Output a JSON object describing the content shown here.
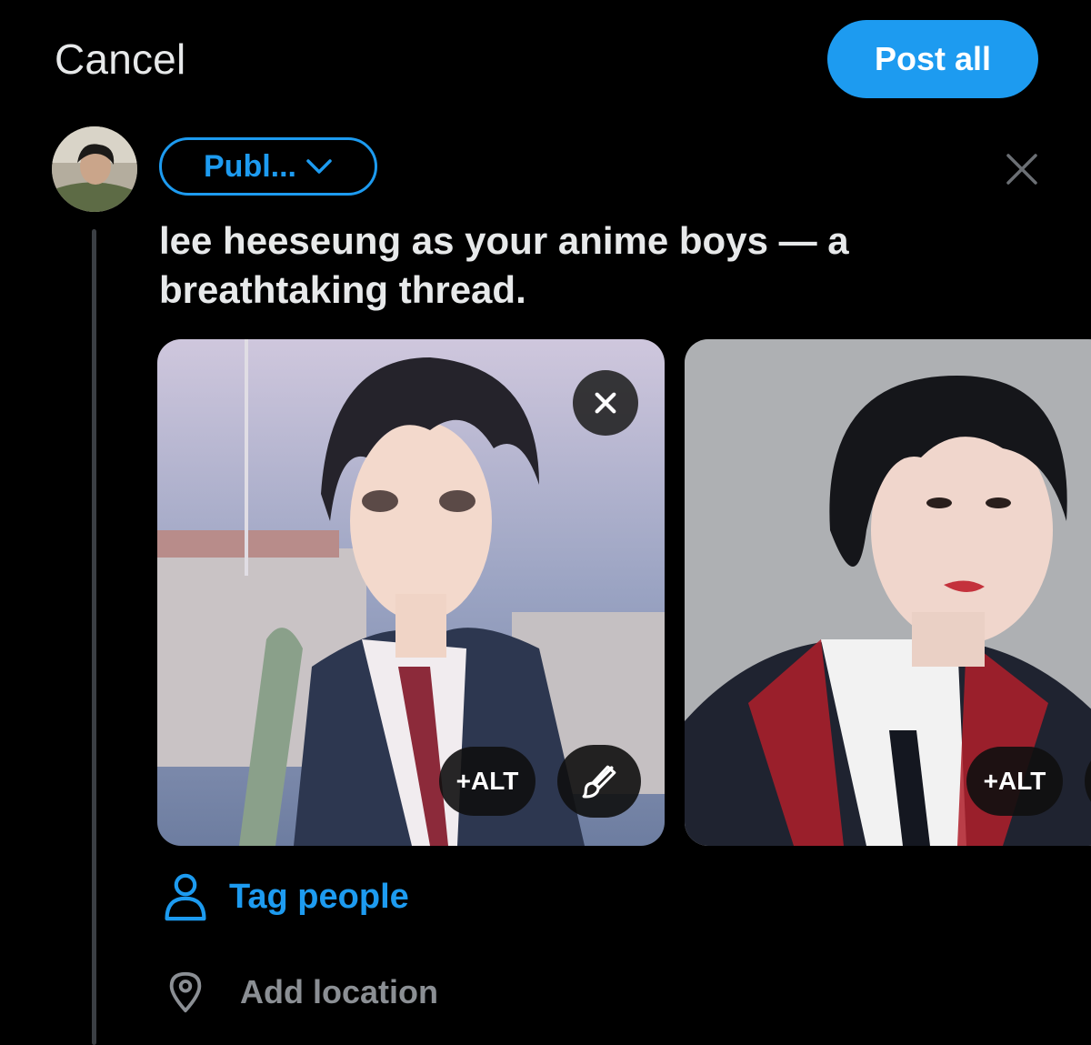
{
  "header": {
    "cancel_label": "Cancel",
    "post_all_label": "Post all"
  },
  "composer": {
    "audience_label": "Publ...",
    "text": "lee heeseung as your anime boys — a breathtaking thread."
  },
  "media": [
    {
      "alt_label": "+ALT"
    },
    {
      "alt_label": "+ALT"
    }
  ],
  "actions": {
    "tag_people_label": "Tag people",
    "add_location_label": "Add location"
  },
  "colors": {
    "accent": "#1d9bf0",
    "background": "#000000",
    "muted": "#8b8f94"
  }
}
